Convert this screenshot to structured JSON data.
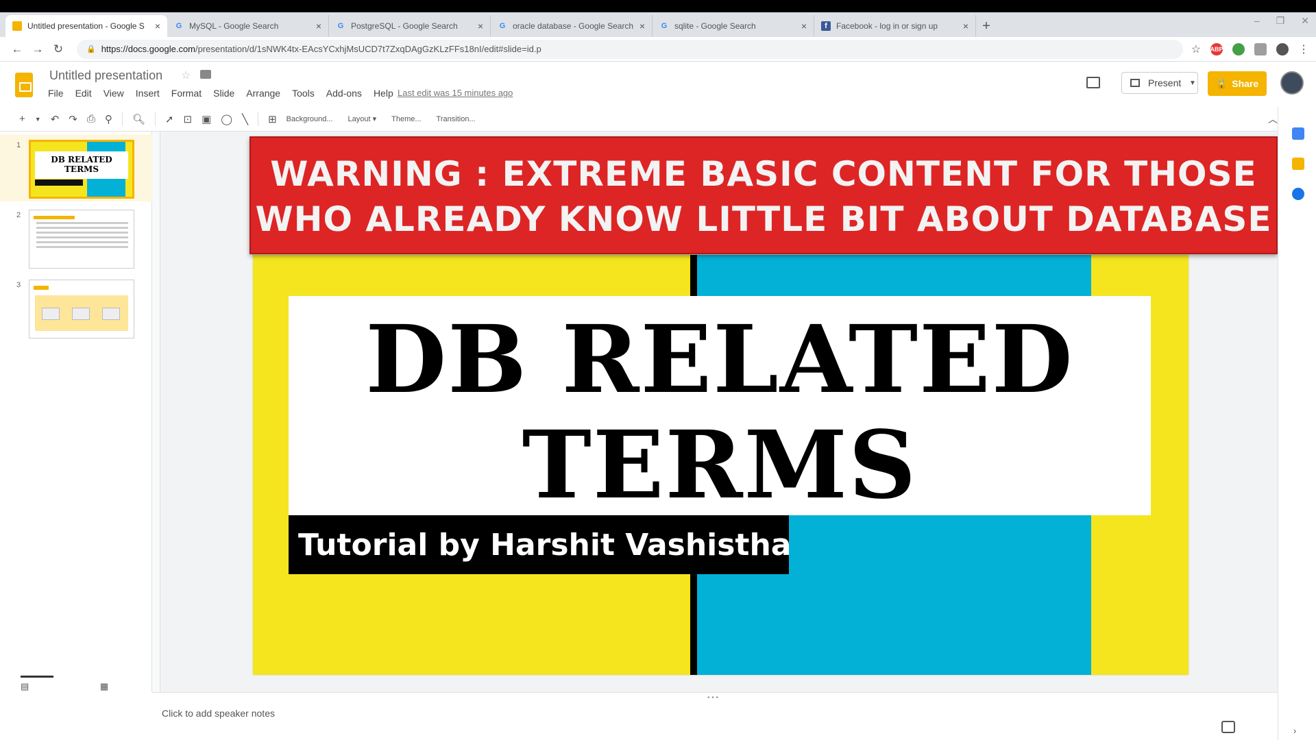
{
  "browser": {
    "tabs": [
      {
        "title": "Untitled presentation - Google S",
        "icon": "slides-icon",
        "active": true
      },
      {
        "title": "MySQL - Google Search",
        "icon": "google-icon"
      },
      {
        "title": "PostgreSQL - Google Search",
        "icon": "google-icon"
      },
      {
        "title": "oracle database - Google Search",
        "icon": "google-icon"
      },
      {
        "title": "sqlite - Google Search",
        "icon": "google-icon"
      },
      {
        "title": "Facebook - log in or sign up",
        "icon": "facebook-icon"
      }
    ],
    "new_tab": "+",
    "url_host": "https://docs.google.com",
    "url_path": "/presentation/d/1sNWK4tx-EAcsYCxhjMsUCD7t7ZxqDAgGzKLzFFs18nI/edit#slide=id.p"
  },
  "app": {
    "doc_title": "Untitled presentation",
    "menu": [
      "File",
      "Edit",
      "View",
      "Insert",
      "Format",
      "Slide",
      "Arrange",
      "Tools",
      "Add-ons",
      "Help"
    ],
    "last_edit": "Last edit was 15 minutes ago",
    "present_label": "Present",
    "share_label": "Share",
    "accent": "#f4b400"
  },
  "toolbar": {
    "background": "Background...",
    "layout": "Layout ▾",
    "theme": "Theme...",
    "transition": "Transition..."
  },
  "filmstrip": {
    "slides": [
      {
        "number": "1",
        "thumb_title": "DB RELATED TERMS"
      },
      {
        "number": "2"
      },
      {
        "number": "3"
      }
    ]
  },
  "slide": {
    "title_line1": "DB  RELATED",
    "title_line2": "TERMS",
    "subtitle": "Tutorial by Harshit Vashistha",
    "colors": {
      "yellow": "#f5e51f",
      "cyan": "#04b1d6",
      "black": "#000000"
    }
  },
  "overlay": {
    "warning_line1": "WARNING : EXTREME BASIC CONTENT FOR THOSE",
    "warning_line2": "WHO ALREADY KNOW LITTLE BIT ABOUT DATABASE",
    "color": "#dd2525"
  },
  "notes": {
    "placeholder": "Click to add speaker notes"
  }
}
